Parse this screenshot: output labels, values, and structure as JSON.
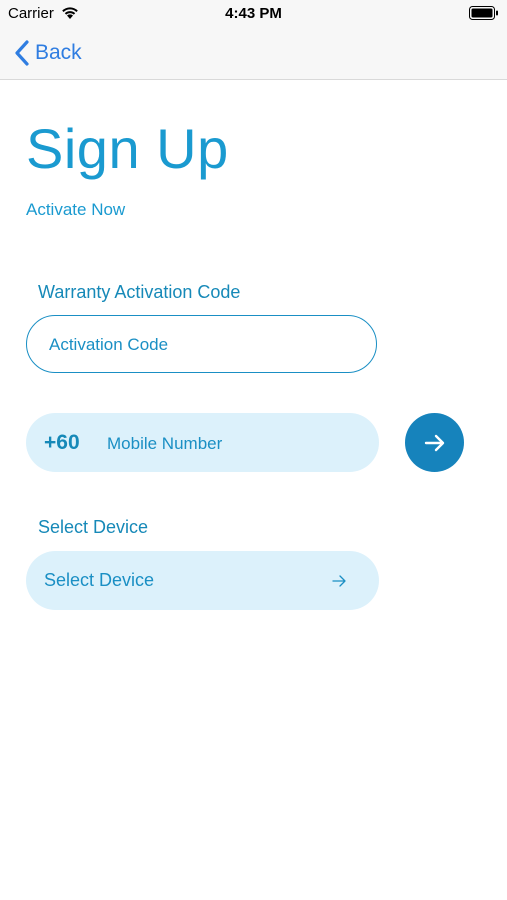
{
  "status_bar": {
    "carrier": "Carrier",
    "time": "4:43 PM"
  },
  "nav": {
    "back_label": "Back"
  },
  "header": {
    "title": "Sign Up",
    "subtitle": "Activate Now"
  },
  "activation": {
    "label": "Warranty Activation Code",
    "placeholder": "Activation Code",
    "value": ""
  },
  "mobile": {
    "country_code": "+60",
    "placeholder": "Mobile Number",
    "value": ""
  },
  "device": {
    "label": "Select Device",
    "selected": "Select Device"
  },
  "icons": {
    "back": "chevron-left-icon",
    "next": "arrow-right-icon",
    "device_arrow": "arrow-right-icon",
    "wifi": "wifi-icon",
    "battery": "battery-icon"
  },
  "colors": {
    "accent": "#1a8fc4",
    "button": "#1683bc",
    "field_fill": "#dcf1fb",
    "ios_blue": "#2f7de1"
  }
}
